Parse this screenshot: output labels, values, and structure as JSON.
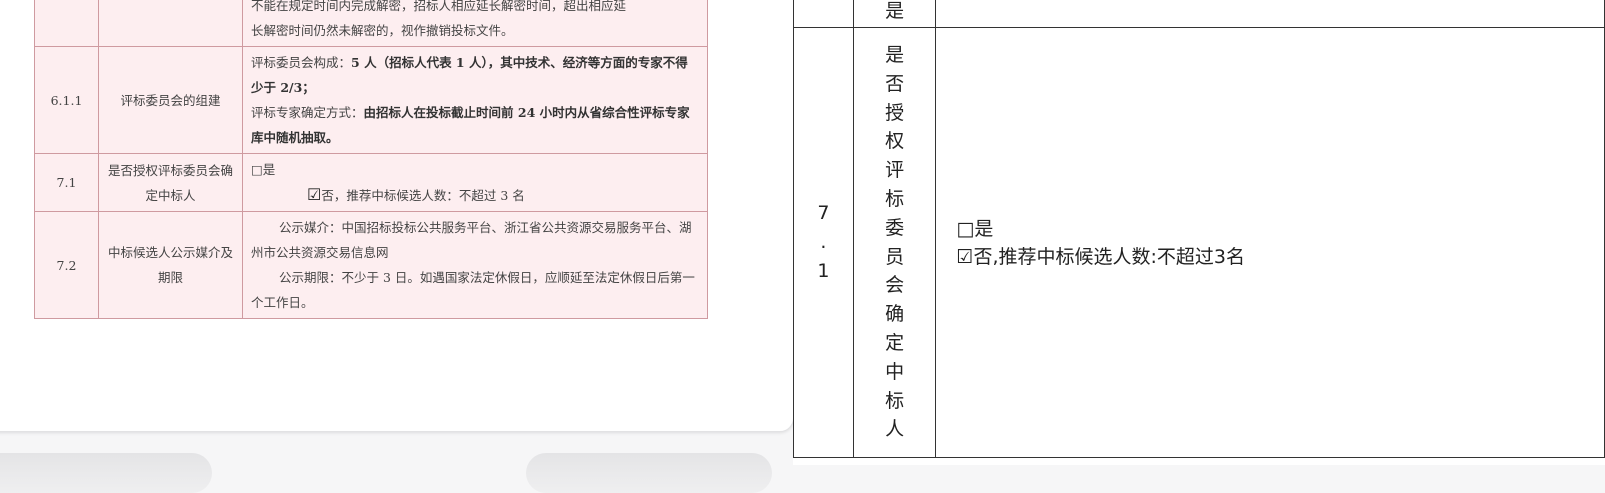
{
  "document": {
    "row0": {
      "line1": "不能在规定时间内完成解密，招标人相应延长解密时间，超出相应延",
      "line2": "长解密时间仍然未解密的，视作撤销投标文件。"
    },
    "row1": {
      "num": "6.1.1",
      "label": "评标委员会的组建",
      "p1_prefix": "评标委员会构成：",
      "p1_bold": "5 人（招标人代表 1 人），其中技术、经济等方面的专家不得少于 2/3；",
      "p2_prefix": "评标专家确定方式：",
      "p2_bold": "由招标人在投标截止时间前 24 小时内从省综合性评标专家库中随机抽取。"
    },
    "row2": {
      "num": "7.1",
      "label": "是否授权评标委员会确定中标人",
      "opt_yes": "□是",
      "check": "☑",
      "opt_no": "否，推荐中标候选人数：不超过 3 名"
    },
    "row3": {
      "num": "7.2",
      "label": "中标候选人公示媒介及期限",
      "p1": "公示媒介：中国招标投标公共服务平台、浙江省公共资源交易服务平台、湖州市公共资源交易信息网",
      "p2": "公示期限：不少于 3 日。如遇国家法定休假日，应顺延至法定休假日后第一个工作日。"
    }
  },
  "extract": {
    "prev_row_label": "是",
    "row": {
      "num_chars": [
        "7",
        ".",
        "1"
      ],
      "label_chars": [
        "是",
        "否",
        "授",
        "权",
        "评",
        "标",
        "委",
        "员",
        "会",
        "确",
        "定",
        "中",
        "标",
        "人"
      ],
      "yes": "□是",
      "no": "☑否,推荐中标候选人数:不超过3名"
    }
  }
}
